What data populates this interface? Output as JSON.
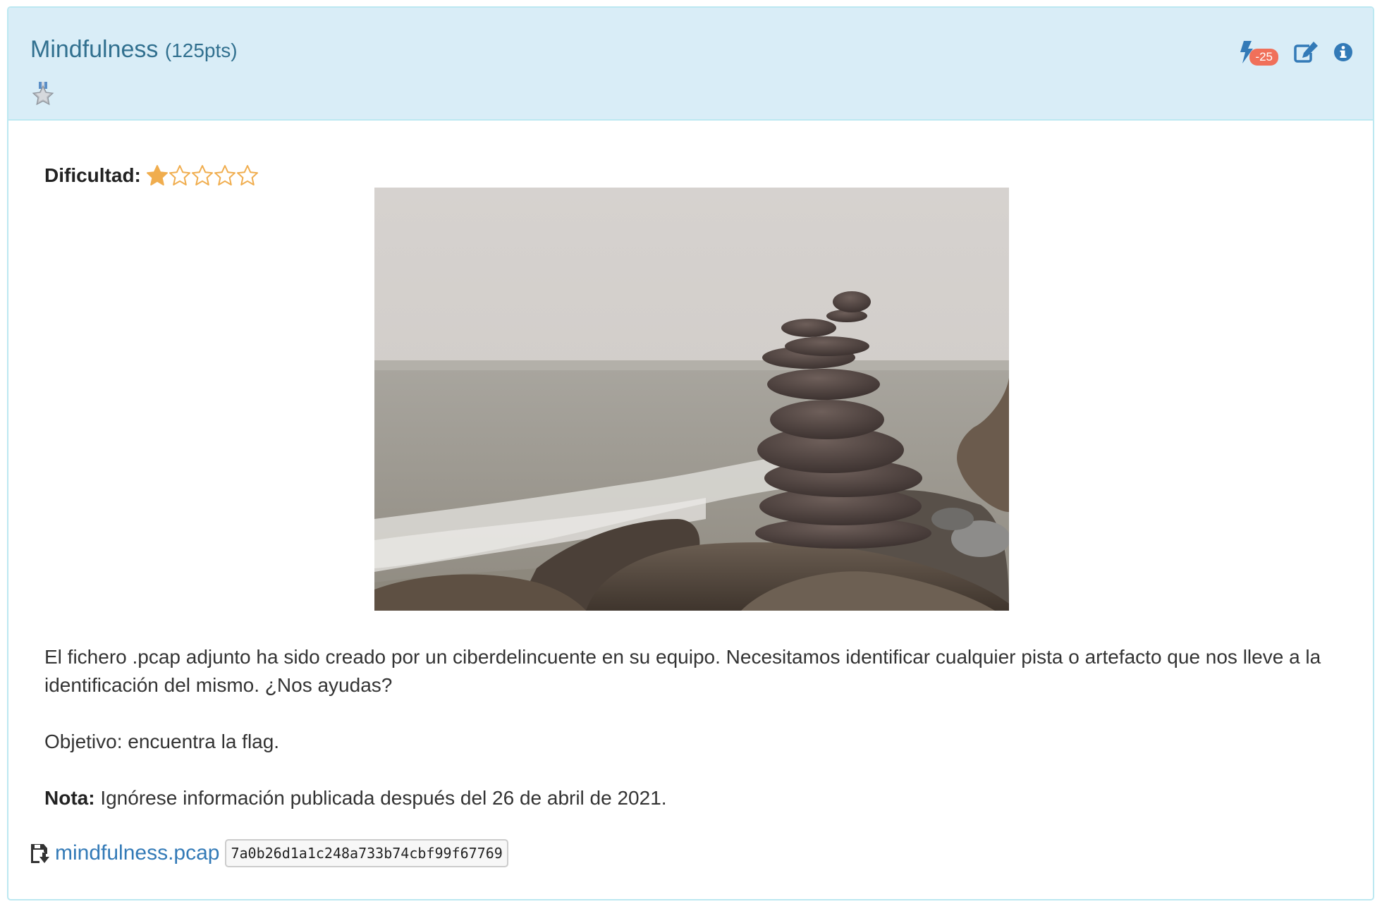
{
  "challenge": {
    "title": "Mindfulness",
    "points": "(125pts)",
    "medal_icon": "medal-star-icon",
    "penalty_badge": "-25",
    "colors": {
      "heading_bg": "#d9edf7",
      "heading_text": "#31708f",
      "link": "#337ab7",
      "star": "#f0ad4e",
      "penalty": "#f0705a"
    }
  },
  "actions": [
    {
      "name": "hint-bolt-icon"
    },
    {
      "name": "edit-icon"
    },
    {
      "name": "info-icon"
    }
  ],
  "difficulty": {
    "label": "Dificultad:",
    "rating": 1,
    "max": 5
  },
  "image": {
    "subject": "stacked-stones-photo"
  },
  "description": {
    "paragraph1": "El fichero .pcap adjunto ha sido creado por un ciberdelincuente en su equipo. Necesitamos identificar cualquier pista o artefacto que nos lleve a la identificación del mismo. ¿Nos ayudas?",
    "objective": "Objetivo: encuentra la flag.",
    "note_label": "Nota:",
    "note_text": " Ignórese información publicada después del 26 de abril de 2021."
  },
  "attachment": {
    "icon": "file-download-icon",
    "filename": "mindfulness.pcap",
    "hash": "7a0b26d1a1c248a733b74cbf99f67769"
  }
}
